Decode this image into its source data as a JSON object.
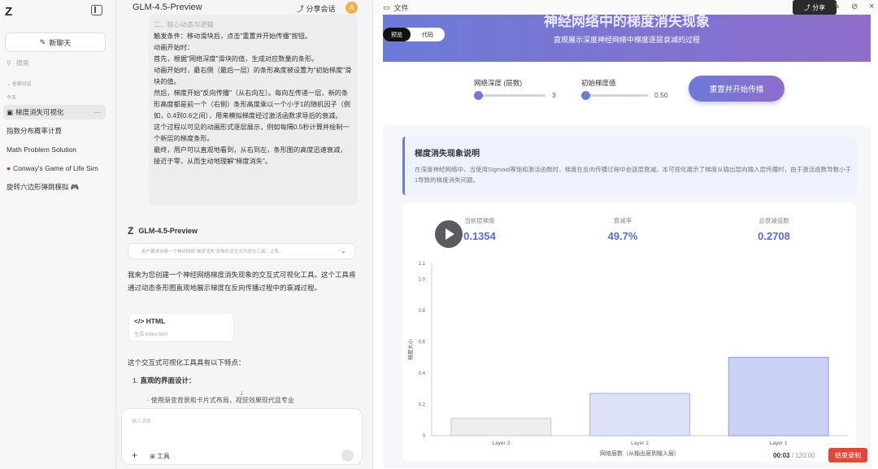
{
  "sidebar": {
    "logo": "Z",
    "new_chat": "新聊天",
    "search_placeholder": "搜索",
    "section_all": "全部对话",
    "section_today": "今天",
    "items": [
      {
        "label": "梯度消失可视化",
        "icon": "▣"
      },
      {
        "label": "指数分布概率计算",
        "icon": ""
      },
      {
        "label": "Math Problem Solution",
        "icon": ""
      },
      {
        "label": "Conway's Game of Life Sim",
        "icon": "●"
      },
      {
        "label": "旋转六边形弹跳模拟 🎮",
        "icon": ""
      }
    ],
    "more": "···"
  },
  "chat": {
    "title": "GLM-4.5-Preview",
    "share": "分享会话",
    "avatar": "A",
    "user_msg": [
      "二、核心动态与逻辑",
      "触发条件：移动滑块后，点击\"重置并开始传播\"按钮。",
      "动画开始时：",
      "首先，根据\"网络深度\"滑块的值，生成对应数量的条形。",
      "动画开始时，最右侧（最后一层）的条形高度被设置为\"初始梯度\"滑块的值。",
      "然后，梯度开始\"反向传播\"（从右向左）。每向左传递一层，新的条形高度都是前一个（右侧）条形高度乘以一个小于1的随机因子（例如，0.4到0.6之间），用来模拟梯度经过激活函数求导后的衰减。",
      "这个过程以可见的动画形式逐层展示，例如每隔0.5秒计算并绘制一个新层的梯度条形。",
      "最终，用户可以直观地看到，从右到左，条形图的高度迅速衰减，接近于零，从而生动地理解\"梯度消失\"。"
    ],
    "reply_model": "GLM-4.5-Preview",
    "reply_collapsed": "用户要求创建一个神经网络\"梯度消失\"现象的交互式可视化工具。让我...",
    "reply_intro": "我来为您创建一个神经网络梯度消失现象的交互式可视化工具。这个工具将通过动态条形图直观地展示梯度在反向传播过程中的衰减过程。",
    "html_card_title": "HTML",
    "html_card_sub": "生成 index.html",
    "features_title": "这个交互式可视化工具具有以下特点：",
    "feature1_num": "1.",
    "feature1": "直观的界面设计：",
    "feature1_sub": "使用渐变背景和卡片式布局，视觉效果现代且专业",
    "input_placeholder": "输入消息",
    "add": "+",
    "tools": "工具"
  },
  "preview": {
    "file_label": "文件",
    "share": "分享",
    "app": {
      "title": "神经网络中的梯度消失现象",
      "subtitle": "直观展示深度神经网络中梯度逐层衰减的过程",
      "tab_preview": "预览",
      "tab_code": "代码",
      "depth_label": "网络深度 (层数)",
      "depth_value": "3",
      "depth_fraction": 0.0,
      "grad_label": "初始梯度值",
      "grad_value": "0.50",
      "grad_fraction": 0.0,
      "reset_button": "重置并开始传播",
      "explain_title": "梯度消失现象说明",
      "explain_body": "在深度神经网络中，当使用Sigmoid等饱和激活函数时，梯度在反向传播过程中会逐层衰减。本可视化展示了梯度从输出层向输入层传播时，由于激活函数导数小于1导致的梯度消失问题。",
      "stats": [
        {
          "label": "当前层梯度",
          "value": "0.1354"
        },
        {
          "label": "衰减率",
          "value": "49.7%"
        },
        {
          "label": "总衰减倍数",
          "value": "0.2708"
        }
      ]
    },
    "timer_current": "00:03",
    "timer_total": "120:00",
    "stop_button": "结束录制"
  },
  "chart_data": {
    "type": "bar",
    "categories": [
      "Layer 3",
      "Layer 2",
      "Layer 1"
    ],
    "values": [
      0.11,
      0.27,
      0.5
    ],
    "xlabel": "网络层数（从输出层到输入层）",
    "ylabel": "梯度大小",
    "ylim": [
      0,
      1.1
    ],
    "yticks": [
      "0",
      "0.2",
      "0.4",
      "0.6",
      "0.8",
      "1.0",
      "1.1"
    ],
    "colors": [
      "#eeeeee",
      "#dde2f8",
      "#c9d1f6"
    ],
    "border_colors": [
      "#c8c8c8",
      "#a9b2ea",
      "#8f9ce6"
    ]
  }
}
